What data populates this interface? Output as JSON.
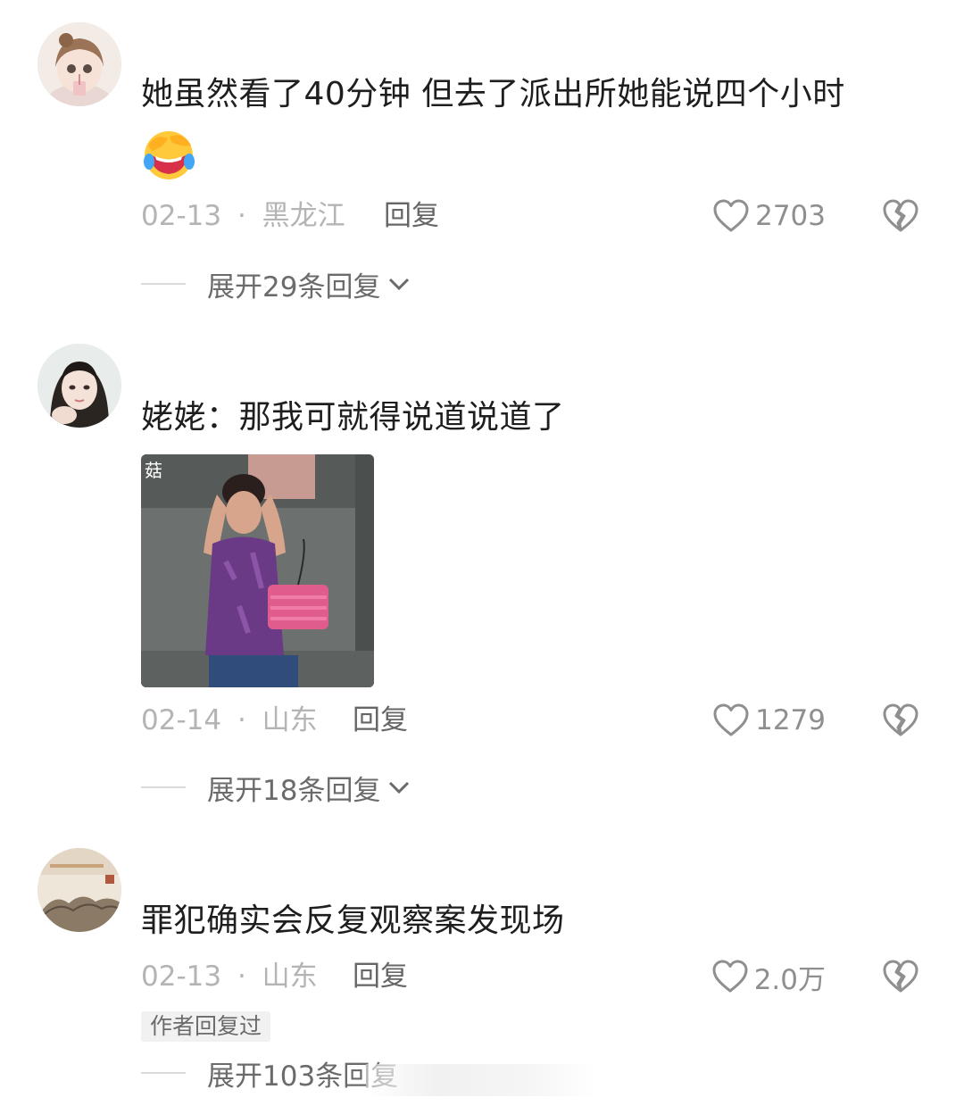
{
  "comments": [
    {
      "text": "她虽然看了40分钟  但去了派出所她能说四个小时",
      "emoji": "laughing-crying-emoji",
      "date": "02-13",
      "separator": "·",
      "location": "黑龙江",
      "reply_label": "回复",
      "likes": "2703",
      "expand_label": "展开29条回复"
    },
    {
      "text": "姥姥：那我可就得说道说道了",
      "date": "02-14",
      "separator": "·",
      "location": "山东",
      "reply_label": "回复",
      "likes": "1279",
      "expand_label": "展开18条回复",
      "image_watermark": "菇"
    },
    {
      "text": "罪犯确实会反复观察案发现场",
      "date": "02-13",
      "separator": "·",
      "location": "山东",
      "reply_label": "回复",
      "likes": "2.0万",
      "author_tag": "作者回复过",
      "expand_label": "展开103条回复"
    }
  ],
  "colors": {
    "text": "#1e1e1e",
    "meta": "#b4b4b4",
    "reply": "#666666",
    "icon": "#8f8f8f"
  }
}
